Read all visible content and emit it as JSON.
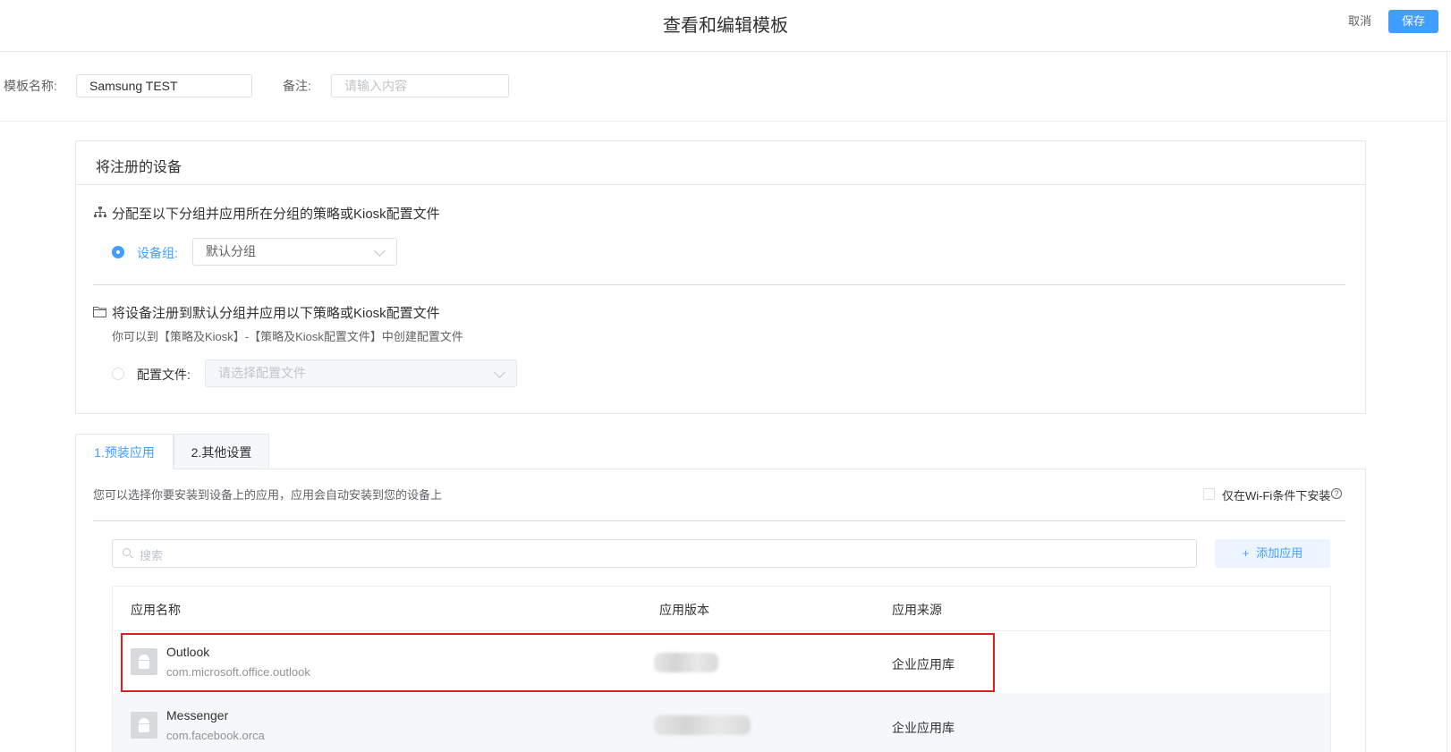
{
  "header": {
    "title": "查看和编辑模板",
    "cancel_label": "取消",
    "save_label": "保存"
  },
  "template": {
    "name_label": "模板名称:",
    "name_value": "Samsung TEST",
    "remark_label": "备注:",
    "remark_placeholder": "请输入内容"
  },
  "devices_panel": {
    "title": "将注册的设备",
    "option_group": {
      "title": "分配至以下分组并应用所在分组的策略或Kiosk配置文件",
      "radio_label": "设备组:",
      "selected": "默认分组",
      "checked": true
    },
    "option_profile": {
      "title": "将设备注册到默认分组并应用以下策略或Kiosk配置文件",
      "hint": "你可以到【策略及Kiosk】-【策略及Kiosk配置文件】中创建配置文件",
      "radio_label": "配置文件:",
      "placeholder": "请选择配置文件",
      "checked": false
    }
  },
  "tabs": [
    {
      "label": "1.预装应用",
      "active": true
    },
    {
      "label": "2.其他设置",
      "active": false
    }
  ],
  "apps_tab": {
    "description": "您可以选择你要安装到设备上的应用，应用会自动安装到您的设备上",
    "wifi_only_label": "仅在Wi-Fi条件下安装",
    "wifi_only_checked": false,
    "search_placeholder": "搜索",
    "add_button": "添加应用",
    "columns": [
      "应用名称",
      "应用版本",
      "应用来源"
    ],
    "rows": [
      {
        "name": "Outlook",
        "package": "com.microsoft.office.outlook",
        "source": "企业应用库",
        "icon": "android-icon",
        "highlighted": true
      },
      {
        "name": "Messenger",
        "package": "com.facebook.orca",
        "source": "企业应用库",
        "icon": "android-icon",
        "highlighted": false
      }
    ]
  },
  "colors": {
    "accent": "#409eff",
    "highlight": "#e02020"
  }
}
